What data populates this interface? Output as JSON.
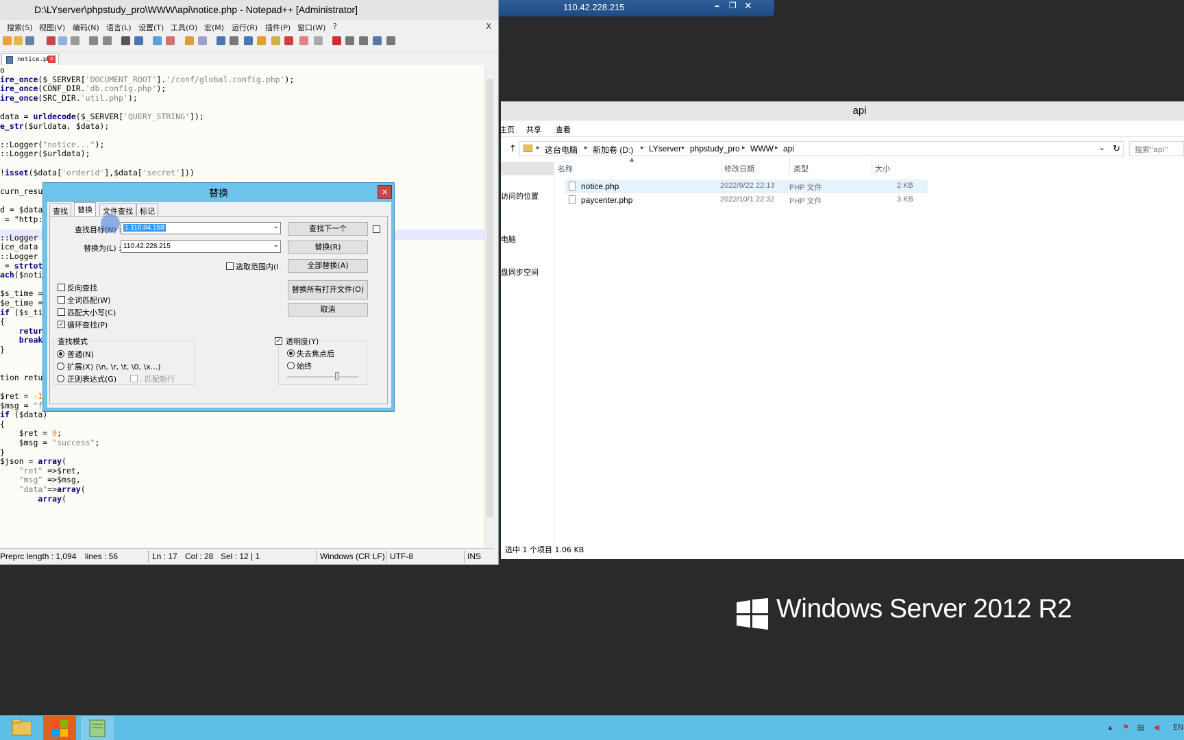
{
  "rdp": {
    "ip": "110.42.228.215"
  },
  "npp": {
    "title": "D:\\LYserver\\phpstudy_pro\\WWW\\api\\notice.php - Notepad++ [Administrator]",
    "menu": [
      "搜索(S)",
      "视图(V)",
      "编码(N)",
      "语言(L)",
      "设置(T)",
      "工具(O)",
      "宏(M)",
      "运行(R)",
      "插件(P)",
      "窗口(W)",
      "?"
    ],
    "menu_close": "X",
    "tab": "notice.php",
    "status": {
      "length": "Preprc length : 1,094",
      "lines": "lines : 56",
      "ln": "Ln : 17",
      "col": "Col : 28",
      "sel": "Sel : 12 | 1",
      "eol": "Windows (CR LF)",
      "enc": "UTF-8",
      "mode": "INS"
    },
    "code_lines": [
      "o",
      "ire_once($_SERVER['DOCUMENT_ROOT'].'/conf/global.config.php');",
      "ire_once(CONF_DIR.'db.config.php');",
      "ire_once(SRC_DIR.'util.php');",
      "",
      "data = urldecode($_SERVER['QUERY_STRING']);",
      "e_str($urldata, $data);",
      "",
      "::Logger(\"notice...\");",
      "::Logger($urldata);",
      "",
      "!isset($data['orderid'],$data['secret']))",
      "",
      "curn_resu",
      "",
      "d = $data",
      " = \"http:",
      "",
      "::Logger",
      "ice_data",
      "::Logger",
      " = strtot",
      "ach($noti",
      "",
      "$s_time =",
      "$e_time =",
      "if ($s_ti",
      "{",
      "    retur",
      "    break",
      "}",
      "",
      "",
      "tion retu",
      "",
      "$ret = -1;",
      "$msg = \"fail\";",
      "if ($data)",
      "{",
      "    $ret = 0;",
      "    $msg = \"success\";",
      "}",
      "$json = array(",
      "    \"ret\" =>$ret,",
      "    \"msg\" =>$msg,",
      "    \"data\"=>array(",
      "        array("
    ]
  },
  "explorer": {
    "title": "api",
    "ribbon": [
      "主页",
      "共享",
      "查看"
    ],
    "crumbs": [
      "这台电脑",
      "新加卷 (D:)",
      "LYserver",
      "phpstudy_pro",
      "WWW",
      "api"
    ],
    "search_placeholder": "搜索\"api\"",
    "nav": [
      "访问的位置",
      "电脑",
      "盘同步空间"
    ],
    "columns": [
      "名称",
      "修改日期",
      "类型",
      "大小"
    ],
    "files": [
      {
        "name": "notice.php",
        "date": "2022/9/22 22:13",
        "type": "PHP 文件",
        "size": "2 KB"
      },
      {
        "name": "paycenter.php",
        "date": "2022/10/1 22:32",
        "type": "PHP 文件",
        "size": "3 KB"
      }
    ],
    "status": "选中 1 个项目  1.06 KB"
  },
  "dialog": {
    "title": "替换",
    "close": "×",
    "tabs": [
      "查找",
      "替换",
      "文件查找",
      "标记"
    ],
    "find_label": "查找目标(N) :",
    "find_value": "1.116.84.158",
    "replace_label": "替换为(L) :",
    "replace_value": "110.42.228.215",
    "in_selection": "选取范围内(I",
    "buttons": {
      "find_next": "查找下一个",
      "replace": "替换(R)",
      "replace_all": "全部替换(A)",
      "replace_all_open": "替换所有打开文件(O)",
      "cancel": "取消"
    },
    "options": [
      "反向查找",
      "全词匹配(W)",
      "匹配大小写(C)",
      "循环查找(P)"
    ],
    "search_mode_title": "查找模式",
    "modes": [
      "普通(N)",
      "扩展(X) (\\n, \\r, \\t, \\0, \\x...)",
      "正则表达式(G)"
    ],
    "dot_newline": ". 匹配新行",
    "transparency": "透明度(Y)",
    "trans_opts": [
      "失去焦点后",
      "始终"
    ]
  },
  "brand": "Windows Server 2012 R2",
  "tray": {
    "lang": "EN"
  },
  "colors": {
    "desktop": "#2a2a2a",
    "taskbar": "#5dbfe8",
    "dialog_frame": "#6dc3ec"
  }
}
